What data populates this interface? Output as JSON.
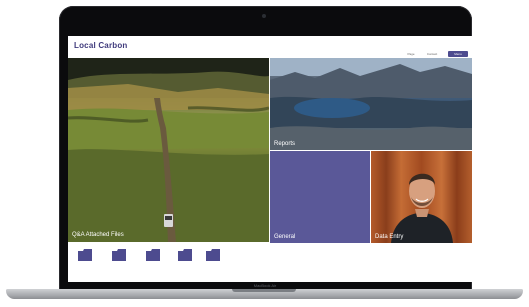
{
  "app": {
    "logo_text": "Local Carbon"
  },
  "header": {
    "buttons": [
      {
        "label": "Page"
      },
      {
        "label": "Contact"
      },
      {
        "label": "Menu"
      }
    ]
  },
  "tiles": [
    {
      "label": "Q&A Attached Files",
      "image": "aerial-farm-road-photo"
    },
    {
      "label": "Reports",
      "image": "mountain-lake-photo"
    },
    {
      "label": "General",
      "color": "#5a5898"
    },
    {
      "label": "Data Entry",
      "image": "smiling-man-portrait-photo"
    }
  ],
  "folders": [
    {
      "icon": "folder-icon"
    },
    {
      "icon": "folder-icon"
    },
    {
      "icon": "folder-icon"
    },
    {
      "icon": "folder-icon"
    },
    {
      "icon": "folder-icon"
    }
  ],
  "device": {
    "brand_label": "MacBook Air"
  },
  "colors": {
    "brand": "#3f3a7c",
    "accent": "#4d4b8f",
    "general_tile": "#5a5898"
  }
}
